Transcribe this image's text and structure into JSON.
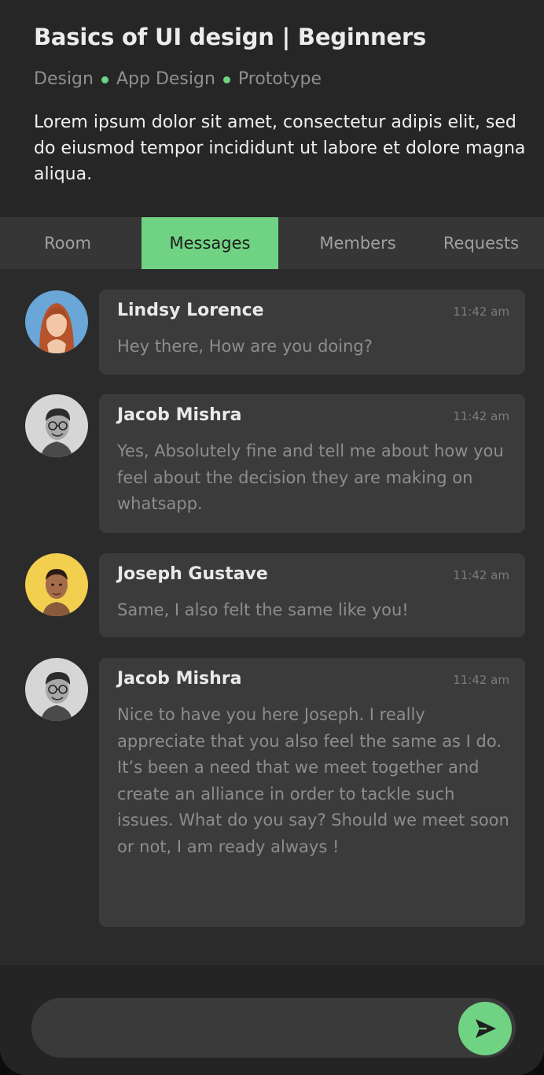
{
  "colors": {
    "accent": "#6fd383",
    "background": "#2b2b2b",
    "header_background": "#262626",
    "bubble_background": "#3b3b3b"
  },
  "course": {
    "title": "Basics of UI design | Beginners",
    "categories": [
      "Design",
      "App Design",
      "Prototype"
    ],
    "description": "Lorem ipsum dolor sit amet, consectetur adipis elit, sed do eiusmod tempor incididunt ut labore et dolore magna aliqua."
  },
  "tabs": [
    {
      "label": "Room",
      "active": false
    },
    {
      "label": "Messages",
      "active": true
    },
    {
      "label": "Members",
      "active": false
    },
    {
      "label": "Requests",
      "active": false
    }
  ],
  "messages": [
    {
      "sender": "Lindsy Lorence",
      "time": "11:42 am",
      "text": "Hey there, How are you doing?",
      "avatar": "avatar-lindsy"
    },
    {
      "sender": "Jacob Mishra",
      "time": "11:42 am",
      "text": "Yes, Absolutely fine and tell me about how you feel about the decision they are making on whatsapp.",
      "avatar": "avatar-jacob"
    },
    {
      "sender": "Joseph Gustave",
      "time": "11:42 am",
      "text": "Same, I also felt the same like you!",
      "avatar": "avatar-joseph"
    },
    {
      "sender": "Jacob Mishra",
      "time": "11:42 am",
      "text": "Nice to have you here Joseph. I really appreciate that you also feel the same as I do. It’s been a need that we meet together and create an alliance in order to tackle such issues. What do you say? Should we meet soon or not, I am ready always !",
      "avatar": "avatar-jacob"
    }
  ],
  "composer": {
    "input_value": "",
    "placeholder": "",
    "send_icon": "send-icon"
  }
}
